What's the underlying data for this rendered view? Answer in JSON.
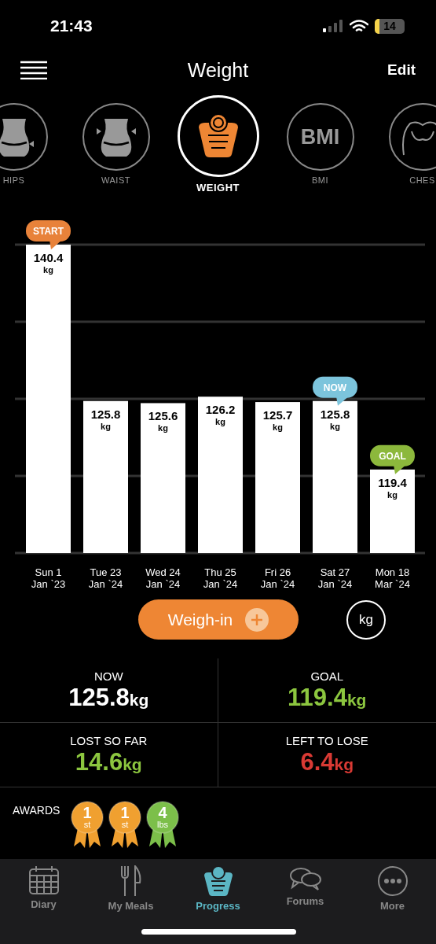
{
  "status_bar": {
    "time": "21:43",
    "battery": "14"
  },
  "header": {
    "title": "Weight",
    "action": "Edit"
  },
  "measures": [
    {
      "kind": "hips",
      "label": "HIPS",
      "selected": false
    },
    {
      "kind": "waist",
      "label": "WAIST",
      "selected": false
    },
    {
      "kind": "weight",
      "label": "WEIGHT",
      "selected": true
    },
    {
      "kind": "bmi",
      "label": "BMI",
      "icon_text": "BMI",
      "selected": false
    },
    {
      "kind": "chest",
      "label": "CHES",
      "selected": false
    }
  ],
  "chart": {
    "bars": [
      {
        "unit": "kg",
        "callout": {
          "label": "START",
          "color": "#e8823a"
        }
      },
      {
        "unit": "kg"
      },
      {
        "unit": "kg"
      },
      {
        "unit": "kg"
      },
      {
        "unit": "kg"
      },
      {
        "unit": "kg",
        "callout": {
          "label": "NOW",
          "color": "#7cc4dc"
        }
      },
      {
        "unit": "kg",
        "callout": {
          "label": "GOAL",
          "color": "#8cb83c"
        }
      }
    ],
    "chart_data": {
      "type": "bar",
      "categories": [
        "Sun 1\nJan `23",
        "Tue 23\nJan `24",
        "Wed 24\nJan `24",
        "Thu 25\nJan `24",
        "Fri 26\nJan `24",
        "Sat 27\nJan `24",
        "Mon 18\nMar `24"
      ],
      "values": [
        140.4,
        125.8,
        125.6,
        126.2,
        125.7,
        125.8,
        119.4
      ],
      "ylim": [
        111.6,
        140.4
      ],
      "data_labels": true
    }
  },
  "weigh_in": {
    "label": "Weigh-in"
  },
  "unit_toggle": {
    "label": "kg"
  },
  "stats": [
    {
      "label": "NOW",
      "value": "125.8",
      "unit": "kg",
      "color": "#ffffff"
    },
    {
      "label": "GOAL",
      "value": "119.4",
      "unit": "kg",
      "color": "#8cc63f"
    },
    {
      "label": "LOST SO FAR",
      "value": "14.6",
      "unit": "kg",
      "color": "#8cc63f"
    },
    {
      "label": "LEFT TO LOSE",
      "value": "6.4",
      "unit": "kg",
      "color": "#d93a34"
    }
  ],
  "awards": {
    "label": "AWARDS",
    "items": [
      {
        "number": "1",
        "unit": "st",
        "color": "#f0a030"
      },
      {
        "number": "1",
        "unit": "st",
        "color": "#f0a030"
      },
      {
        "number": "4",
        "unit": "lbs",
        "color": "#7cbf4a"
      }
    ]
  },
  "tab_bar": [
    {
      "kind": "diary",
      "label": "Diary",
      "selected": false
    },
    {
      "kind": "meals",
      "label": "My Meals",
      "selected": false
    },
    {
      "kind": "progress",
      "label": "Progress",
      "selected": true
    },
    {
      "kind": "forums",
      "label": "Forums",
      "selected": false
    },
    {
      "kind": "more",
      "label": "More",
      "selected": false
    }
  ]
}
